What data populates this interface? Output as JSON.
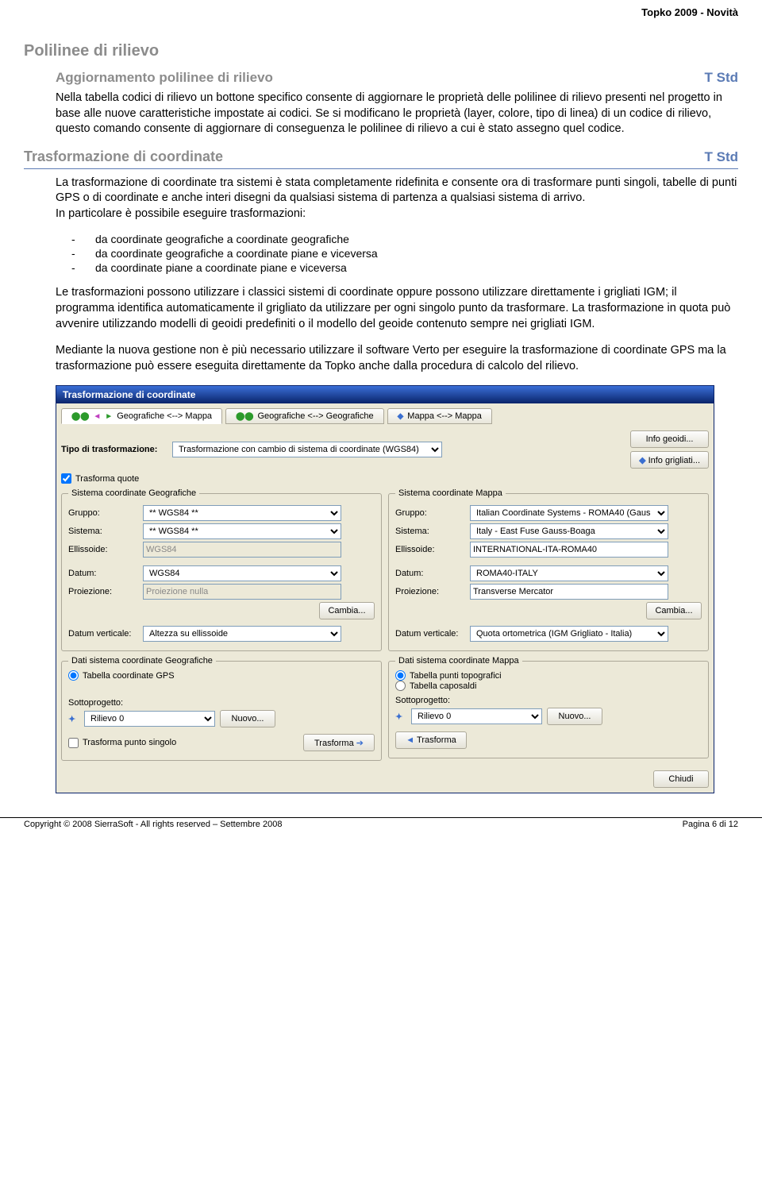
{
  "doc": {
    "header_right": "Topko 2009 - Novità",
    "h1": "Polilinee di rilievo",
    "sec1": {
      "title": "Aggiornamento polilinee di rilievo",
      "tag": "T Std",
      "body": "Nella tabella codici di rilievo un bottone specifico consente di aggiornare le proprietà delle polilinee di rilievo presenti nel progetto in base alle nuove caratteristiche impostate ai codici. Se si modificano le proprietà (layer, colore, tipo di linea) di un codice di rilievo, questo comando consente di aggiornare di conseguenza le polilinee di rilievo a cui è stato assegno quel codice."
    },
    "sec2": {
      "title": "Trasformazione di coordinate",
      "tag": "T Std",
      "p1": "La trasformazione di coordinate tra sistemi è stata completamente ridefinita e consente ora di trasformare punti singoli, tabelle di punti GPS o di coordinate e anche interi disegni da qualsiasi sistema di partenza a qualsiasi sistema di arrivo.",
      "p1b": "In particolare è possibile eseguire trasformazioni:",
      "b1": "da coordinate geografiche a coordinate geografiche",
      "b2": "da coordinate geografiche a coordinate piane e viceversa",
      "b3": "da coordinate piane a coordinate piane e viceversa",
      "p2": "Le trasformazioni possono utilizzare i classici sistemi di coordinate oppure possono utilizzare direttamente i grigliati IGM; il programma identifica automaticamente il grigliato da utilizzare per ogni singolo punto da trasformare. La trasformazione in quota può avvenire utilizzando modelli di geoidi predefiniti o il modello del geoide contenuto sempre nei grigliati IGM.",
      "p3": "Mediante la nuova gestione non è più necessario utilizzare il software Verto per eseguire la trasformazione di coordinate GPS ma la trasformazione può essere eseguita direttamente da Topko anche dalla procedura di calcolo del rilievo."
    },
    "copyright": "Copyright © 2008 SierraSoft - All rights reserved – Settembre 2008",
    "page": "Pagina 6 di 12"
  },
  "dlg": {
    "title": "Trasformazione di coordinate",
    "tabs": {
      "t1": "Geografiche <--> Mappa",
      "t2": "Geografiche <--> Geografiche",
      "t3": "Mappa <--> Mappa"
    },
    "tipo_lbl": "Tipo di trasformazione:",
    "tipo_val": "Trasformazione con cambio di sistema di coordinate (WGS84)",
    "info_geoidi": "Info geoidi...",
    "info_grigliati": "Info grigliati...",
    "trasforma_quote": "Trasforma quote",
    "left_panel": {
      "legend": "Sistema coordinate Geografiche",
      "gruppo_lbl": "Gruppo:",
      "gruppo_val": "** WGS84 **",
      "sistema_lbl": "Sistema:",
      "sistema_val": "** WGS84 **",
      "ellissoide_lbl": "Ellissoide:",
      "ellissoide_val": "WGS84",
      "datum_lbl": "Datum:",
      "datum_val": "WGS84",
      "proiezione_lbl": "Proiezione:",
      "proiezione_val": "Proiezione nulla",
      "cambia": "Cambia...",
      "datumv_lbl": "Datum verticale:",
      "datumv_val": "Altezza su ellissoide"
    },
    "right_panel": {
      "legend": "Sistema coordinate Mappa",
      "gruppo_lbl": "Gruppo:",
      "gruppo_val": "Italian Coordinate Systems - ROMA40 (Gaus",
      "sistema_lbl": "Sistema:",
      "sistema_val": "Italy - East Fuse Gauss-Boaga",
      "ellissoide_lbl": "Ellissoide:",
      "ellissoide_val": "INTERNATIONAL-ITA-ROMA40",
      "datum_lbl": "Datum:",
      "datum_val": "ROMA40-ITALY",
      "proiezione_lbl": "Proiezione:",
      "proiezione_val": "Transverse Mercator",
      "cambia": "Cambia...",
      "datumv_lbl": "Datum verticale:",
      "datumv_val": "Quota ortometrica (IGM Grigliato - Italia)"
    },
    "data_left": {
      "legend": "Dati sistema coordinate Geografiche",
      "r1": "Tabella coordinate GPS",
      "sotto_lbl": "Sottoprogetto:",
      "sotto_val": "Rilievo 0",
      "nuovo": "Nuovo...",
      "singolo": "Trasforma punto singolo",
      "trasforma": "Trasforma"
    },
    "data_right": {
      "legend": "Dati sistema coordinate Mappa",
      "r1": "Tabella punti topografici",
      "r2": "Tabella caposaldi",
      "sotto_lbl": "Sottoprogetto:",
      "sotto_val": "Rilievo 0",
      "nuovo": "Nuovo...",
      "trasforma": "Trasforma"
    },
    "chiudi": "Chiudi"
  }
}
